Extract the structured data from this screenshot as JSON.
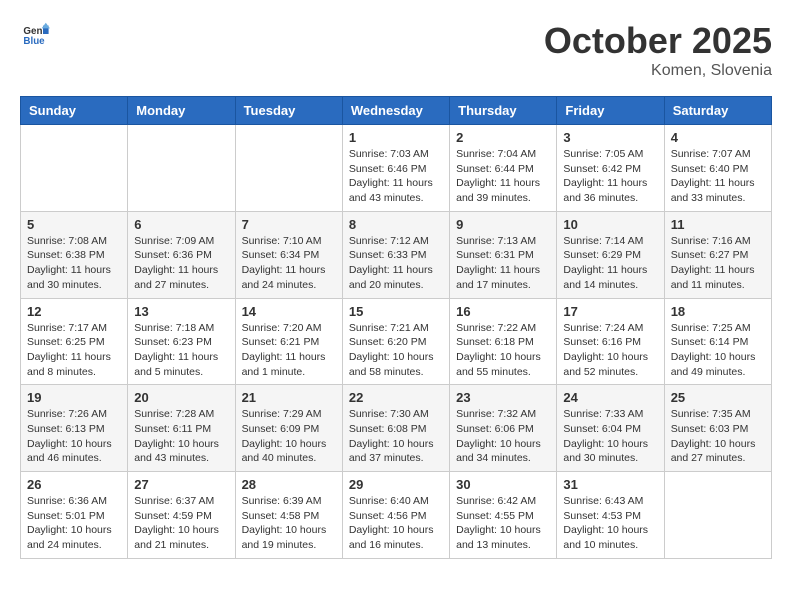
{
  "header": {
    "logo_general": "General",
    "logo_blue": "Blue",
    "month": "October 2025",
    "location": "Komen, Slovenia"
  },
  "weekdays": [
    "Sunday",
    "Monday",
    "Tuesday",
    "Wednesday",
    "Thursday",
    "Friday",
    "Saturday"
  ],
  "weeks": [
    [
      {
        "day": "",
        "info": ""
      },
      {
        "day": "",
        "info": ""
      },
      {
        "day": "",
        "info": ""
      },
      {
        "day": "1",
        "info": "Sunrise: 7:03 AM\nSunset: 6:46 PM\nDaylight: 11 hours\nand 43 minutes."
      },
      {
        "day": "2",
        "info": "Sunrise: 7:04 AM\nSunset: 6:44 PM\nDaylight: 11 hours\nand 39 minutes."
      },
      {
        "day": "3",
        "info": "Sunrise: 7:05 AM\nSunset: 6:42 PM\nDaylight: 11 hours\nand 36 minutes."
      },
      {
        "day": "4",
        "info": "Sunrise: 7:07 AM\nSunset: 6:40 PM\nDaylight: 11 hours\nand 33 minutes."
      }
    ],
    [
      {
        "day": "5",
        "info": "Sunrise: 7:08 AM\nSunset: 6:38 PM\nDaylight: 11 hours\nand 30 minutes."
      },
      {
        "day": "6",
        "info": "Sunrise: 7:09 AM\nSunset: 6:36 PM\nDaylight: 11 hours\nand 27 minutes."
      },
      {
        "day": "7",
        "info": "Sunrise: 7:10 AM\nSunset: 6:34 PM\nDaylight: 11 hours\nand 24 minutes."
      },
      {
        "day": "8",
        "info": "Sunrise: 7:12 AM\nSunset: 6:33 PM\nDaylight: 11 hours\nand 20 minutes."
      },
      {
        "day": "9",
        "info": "Sunrise: 7:13 AM\nSunset: 6:31 PM\nDaylight: 11 hours\nand 17 minutes."
      },
      {
        "day": "10",
        "info": "Sunrise: 7:14 AM\nSunset: 6:29 PM\nDaylight: 11 hours\nand 14 minutes."
      },
      {
        "day": "11",
        "info": "Sunrise: 7:16 AM\nSunset: 6:27 PM\nDaylight: 11 hours\nand 11 minutes."
      }
    ],
    [
      {
        "day": "12",
        "info": "Sunrise: 7:17 AM\nSunset: 6:25 PM\nDaylight: 11 hours\nand 8 minutes."
      },
      {
        "day": "13",
        "info": "Sunrise: 7:18 AM\nSunset: 6:23 PM\nDaylight: 11 hours\nand 5 minutes."
      },
      {
        "day": "14",
        "info": "Sunrise: 7:20 AM\nSunset: 6:21 PM\nDaylight: 11 hours\nand 1 minute."
      },
      {
        "day": "15",
        "info": "Sunrise: 7:21 AM\nSunset: 6:20 PM\nDaylight: 10 hours\nand 58 minutes."
      },
      {
        "day": "16",
        "info": "Sunrise: 7:22 AM\nSunset: 6:18 PM\nDaylight: 10 hours\nand 55 minutes."
      },
      {
        "day": "17",
        "info": "Sunrise: 7:24 AM\nSunset: 6:16 PM\nDaylight: 10 hours\nand 52 minutes."
      },
      {
        "day": "18",
        "info": "Sunrise: 7:25 AM\nSunset: 6:14 PM\nDaylight: 10 hours\nand 49 minutes."
      }
    ],
    [
      {
        "day": "19",
        "info": "Sunrise: 7:26 AM\nSunset: 6:13 PM\nDaylight: 10 hours\nand 46 minutes."
      },
      {
        "day": "20",
        "info": "Sunrise: 7:28 AM\nSunset: 6:11 PM\nDaylight: 10 hours\nand 43 minutes."
      },
      {
        "day": "21",
        "info": "Sunrise: 7:29 AM\nSunset: 6:09 PM\nDaylight: 10 hours\nand 40 minutes."
      },
      {
        "day": "22",
        "info": "Sunrise: 7:30 AM\nSunset: 6:08 PM\nDaylight: 10 hours\nand 37 minutes."
      },
      {
        "day": "23",
        "info": "Sunrise: 7:32 AM\nSunset: 6:06 PM\nDaylight: 10 hours\nand 34 minutes."
      },
      {
        "day": "24",
        "info": "Sunrise: 7:33 AM\nSunset: 6:04 PM\nDaylight: 10 hours\nand 30 minutes."
      },
      {
        "day": "25",
        "info": "Sunrise: 7:35 AM\nSunset: 6:03 PM\nDaylight: 10 hours\nand 27 minutes."
      }
    ],
    [
      {
        "day": "26",
        "info": "Sunrise: 6:36 AM\nSunset: 5:01 PM\nDaylight: 10 hours\nand 24 minutes."
      },
      {
        "day": "27",
        "info": "Sunrise: 6:37 AM\nSunset: 4:59 PM\nDaylight: 10 hours\nand 21 minutes."
      },
      {
        "day": "28",
        "info": "Sunrise: 6:39 AM\nSunset: 4:58 PM\nDaylight: 10 hours\nand 19 minutes."
      },
      {
        "day": "29",
        "info": "Sunrise: 6:40 AM\nSunset: 4:56 PM\nDaylight: 10 hours\nand 16 minutes."
      },
      {
        "day": "30",
        "info": "Sunrise: 6:42 AM\nSunset: 4:55 PM\nDaylight: 10 hours\nand 13 minutes."
      },
      {
        "day": "31",
        "info": "Sunrise: 6:43 AM\nSunset: 4:53 PM\nDaylight: 10 hours\nand 10 minutes."
      },
      {
        "day": "",
        "info": ""
      }
    ]
  ]
}
